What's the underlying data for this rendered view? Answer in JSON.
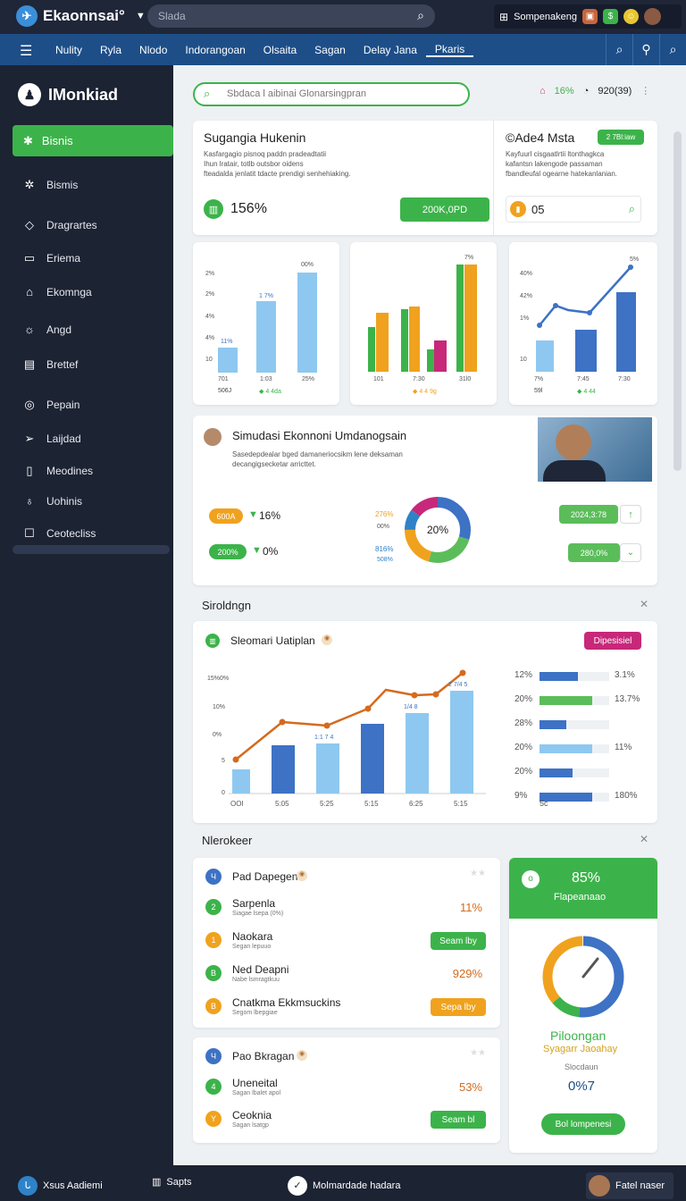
{
  "app": {
    "title": "Ekaonnsai°",
    "search_placeholder": "Slada"
  },
  "topright": {
    "label": "Sompenakeng"
  },
  "nav": {
    "items": [
      "Nulity",
      "Ryla",
      "Nlodo",
      "Indorangoan",
      "Olsaita",
      "Sagan",
      "Delay Jana",
      "Pkaris"
    ]
  },
  "sidebar": {
    "brand": "IMonkiad",
    "active": "Bisnis",
    "items": [
      "Bismis",
      "Dragrartes",
      "Eriema",
      "Ekomnga",
      "Angd",
      "Brettef",
      "Pepain",
      "Laijdad",
      "Meodines",
      "Uohinis",
      "Ceotecliss"
    ]
  },
  "main": {
    "search_placeholder": "Sbdaca l aibinai Glonarsingpran",
    "stat1": "16%",
    "stat2": "920(39)"
  },
  "card1": {
    "title": "Sugangia Hukenin",
    "desc": [
      "Kasfargagio pisnoq paddn pradeadtatii",
      "Ihun lratair, totlb outsbor oidens",
      "fteadalda jenlatit tdacte prendigi senhehiaking."
    ],
    "value": "156%",
    "button": "200K,0PD"
  },
  "card2": {
    "title": "©Ade4 Msta",
    "badge": "2 7Bl:iaw",
    "desc": [
      "Kayfuurl cisgaatlrtii ltonthagkca",
      "kafantsn lakengode passaman",
      "fbandleufal ogearne hatekanlanian."
    ],
    "value": "05"
  },
  "minichart1": {
    "labels": [
      "2%",
      "2%",
      "4%",
      "4%",
      "10"
    ],
    "top": "00%",
    "bars": [
      "11%",
      "1 7%"
    ],
    "xlab": [
      "701",
      "1:03",
      "25%"
    ],
    "leg": [
      "506J",
      "◆ 4 4da"
    ]
  },
  "minichart2": {
    "top": "7%",
    "xlab": [
      "101",
      "7:30",
      "31l0"
    ],
    "leg": "◆ 4 4 9g"
  },
  "minichart3": {
    "top": "5%",
    "labels": [
      "40%",
      "42%",
      "1%",
      "10"
    ],
    "xlab": [
      "7%",
      "7:45",
      "7:30"
    ],
    "leg": [
      "59l",
      "◆ 4 44"
    ]
  },
  "sim": {
    "title": "Simudasi Ekonnoni Umdanogsain",
    "desc": [
      "Sasedepdealar bged damaneriocsikm lene deksaman",
      "decangigsecketar arricttet."
    ],
    "row1": {
      "badge": "600A",
      "delta": "16%"
    },
    "row2": {
      "badge": "200%",
      "delta": "0%"
    },
    "donut_center": "20%",
    "donut_labels": [
      "276%",
      "00%",
      "816%",
      "508%"
    ],
    "right1": "2024,3:78",
    "right2": "280,0%"
  },
  "section1": {
    "title": "Siroldngn"
  },
  "bigcard": {
    "title": "Sleomari Uatiplan",
    "badge": "Dipesisiel",
    "yticks": [
      "15%0%",
      "10%",
      "0%",
      "5",
      "0"
    ],
    "xticks": [
      "OOI",
      "5:05",
      "5:25",
      "5:15",
      "6:25",
      "5:15"
    ],
    "barlabels": [
      "1:1 7 4",
      "1/4 8",
      "2 7/4 5"
    ],
    "hbars": [
      {
        "left": "12%",
        "right": "3.1%",
        "fill": 0.55,
        "color": "#3d72c4"
      },
      {
        "left": "20%",
        "right": "13.7%",
        "fill": 0.75,
        "color": "#5bbd5a"
      },
      {
        "left": "28%",
        "right": "",
        "fill": 0.38,
        "color": "#3d72c4"
      },
      {
        "left": "20%",
        "right": "11%",
        "fill": 0.75,
        "color": "#8ec8f0"
      },
      {
        "left": "20%",
        "right": "",
        "fill": 0.47,
        "color": "#3d72c4"
      },
      {
        "left": "9%",
        "right": "180%",
        "fill": 0.75,
        "color": "#3d72c4"
      }
    ],
    "hbar_foot": "5c"
  },
  "section2": {
    "title": "Nlerokeer"
  },
  "list1": {
    "header": "Pad Dapegen",
    "rows": [
      {
        "n": "2",
        "t": "Sarpenla",
        "s": "Siagae lsepa (0%)",
        "v": "11%"
      },
      {
        "n": "1",
        "t": "Naokara",
        "s": "Segan lepuuo",
        "b": "Seam lby"
      },
      {
        "n": "B",
        "t": "Ned Deapni",
        "s": "Nabe lsmragtkuu",
        "v": "929%"
      },
      {
        "n": "B",
        "t": "Cnatkma Ekkmsuckins",
        "s": "Segom lbepgiae",
        "b": "Sepa lby"
      }
    ]
  },
  "list2": {
    "header": "Pao Bkragan",
    "rows": [
      {
        "n": "4",
        "t": "Uneneital",
        "s": "Sagan lbalet apol",
        "v": "53%"
      },
      {
        "n": "Y",
        "t": "Ceoknia",
        "s": "Sagan lsatgp",
        "b": "Seam bl"
      }
    ]
  },
  "gauge": {
    "value": "85%",
    "label": "Flapeanaao",
    "title": "Piloongan",
    "subtitle": "Syagarr Jaoahay",
    "caption": "Slocdaun",
    "num": "0%7",
    "button": "Bol lompenesi"
  },
  "footer": {
    "left": "Xsus Aadiemi",
    "mid1": "Sapts",
    "mid2": "Molmardade hadara",
    "right": "Fatel naser"
  }
}
